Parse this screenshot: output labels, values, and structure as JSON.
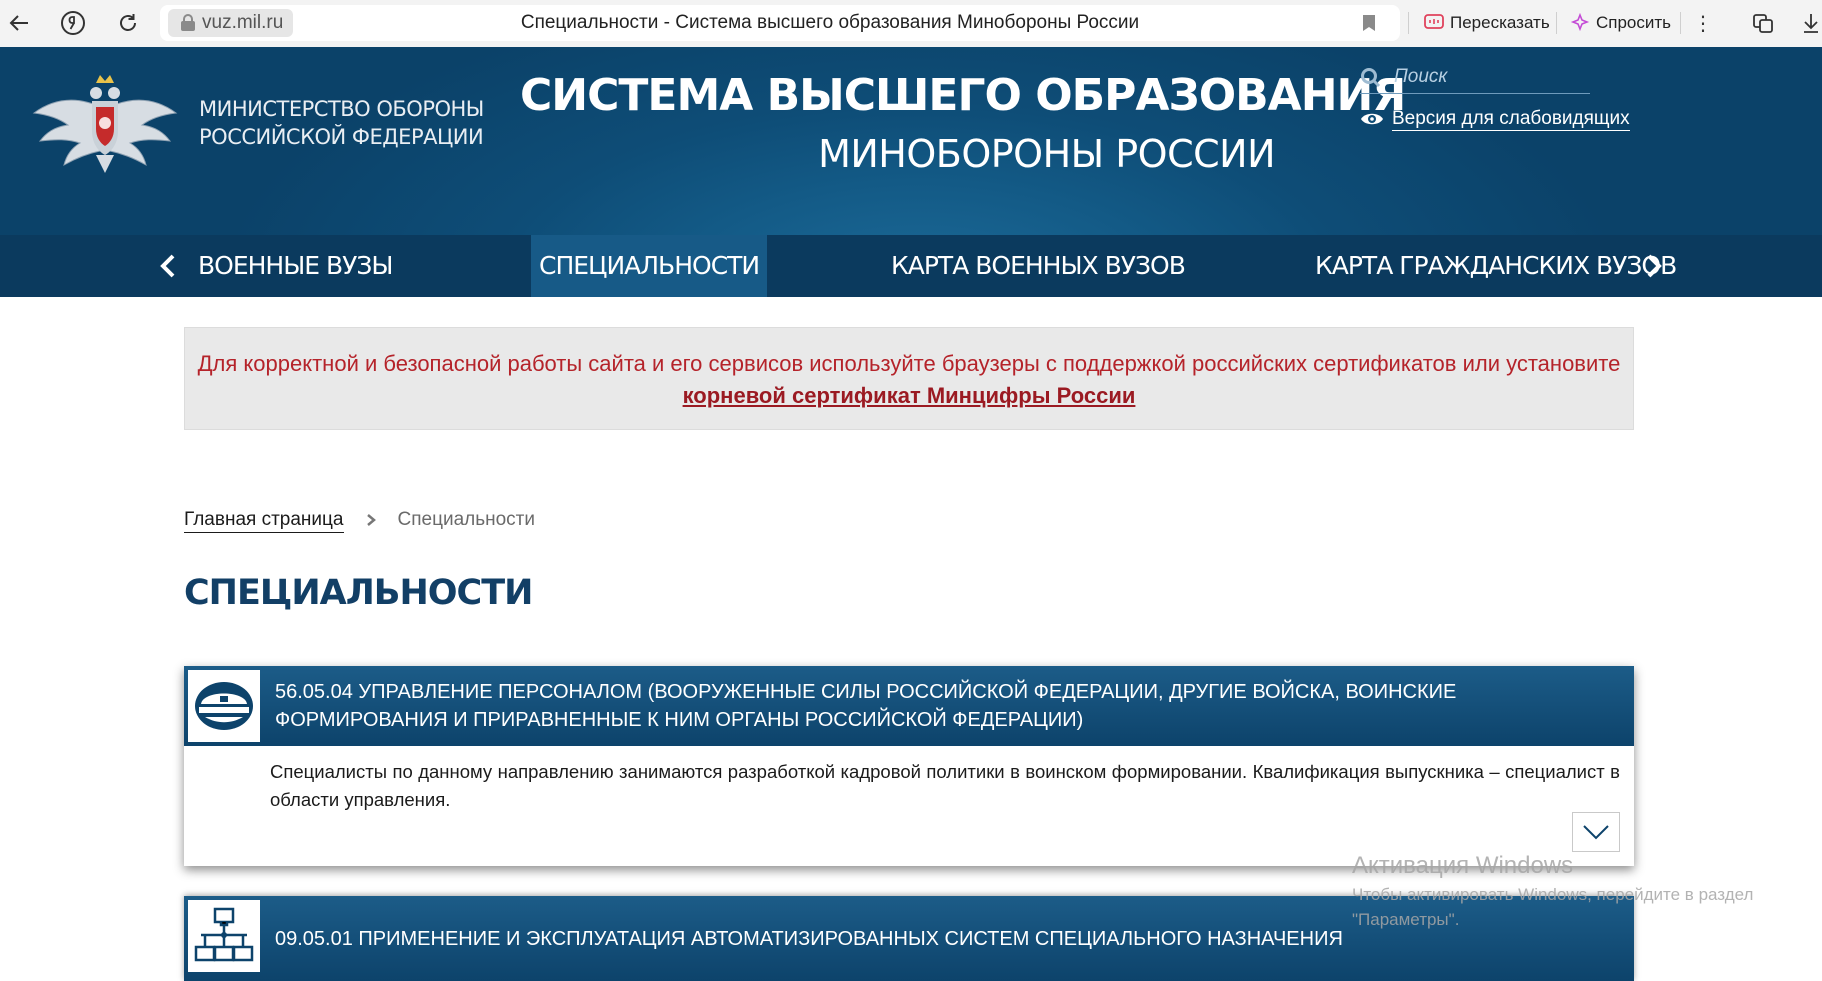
{
  "browser": {
    "host": "vuz.mil.ru",
    "tab_title": "Специальности - Система высшего образования Минобороны России",
    "retell_label": "Пересказать",
    "ask_label": "Спросить"
  },
  "header": {
    "ministry_line1": "МИНИСТЕРСТВО ОБОРОНЫ",
    "ministry_line2": "РОССИЙСКОЙ ФЕДЕРАЦИИ",
    "title": "СИСТЕМА ВЫСШЕГО ОБРАЗОВАНИЯ",
    "subtitle": "МИНОБОРОНЫ РОССИИ",
    "search_placeholder": "Поиск",
    "low_vision_label": "Версия для слабовидящих"
  },
  "nav": {
    "items": [
      {
        "label": "ВОЕННЫЕ ВУЗЫ",
        "active": false
      },
      {
        "label": "СПЕЦИАЛЬНОСТИ",
        "active": true
      },
      {
        "label": "КАРТА ВОЕННЫХ ВУЗОВ",
        "active": false
      },
      {
        "label": "КАРТА ГРАЖДАНСКИХ ВУЗОВ",
        "active": false
      }
    ]
  },
  "notice": {
    "text": "Для корректной и безопасной работы сайта и его сервисов используйте браузеры с поддержкой российских сертификатов или установите",
    "link": "корневой сертификат Минцифры России"
  },
  "breadcrumb": {
    "home": "Главная страница",
    "current": "Специальности"
  },
  "page_title": "СПЕЦИАЛЬНОСТИ",
  "specialties": [
    {
      "title": "56.05.04 УПРАВЛЕНИЕ ПЕРСОНАЛОМ (ВООРУЖЕННЫЕ СИЛЫ РОССИЙСКОЙ ФЕДЕРАЦИИ, ДРУГИЕ ВОЙСКА, ВОИНСКИЕ ФОРМИРОВАНИЯ И ПРИРАВНЕННЫЕ К НИМ ОРГАНЫ РОССИЙСКОЙ ФЕДЕРАЦИИ)",
      "description": "Специалисты по данному направлению занимаются разработкой кадровой политики в воинском формировании. Квалификация выпускника – специалист в области управления.",
      "icon": "officer-cap-icon"
    },
    {
      "title": "09.05.01 ПРИМЕНЕНИЕ И ЭКСПЛУАТАЦИЯ АВТОМАТИЗИРОВАННЫХ СИСТЕМ СПЕЦИАЛЬНОГО НАЗНАЧЕНИЯ",
      "icon": "network-computers-icon"
    }
  ],
  "watermark": {
    "title": "Активация Windows",
    "line1": "Чтобы активировать Windows, перейдите в раздел",
    "line2": "\"Параметры\"."
  },
  "colors": {
    "header_blue": "#0e4d77",
    "nav_dark": "#0b3a5e",
    "nav_active": "#175a87",
    "notice_red": "#b5232a",
    "title_blue": "#123f66"
  }
}
